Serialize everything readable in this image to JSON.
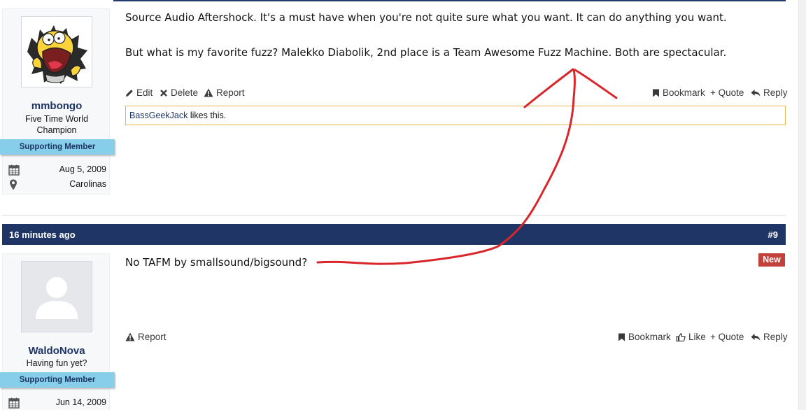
{
  "post1": {
    "author": {
      "username": "mmbongo",
      "title": "Five Time World Champion",
      "banner": "Supporting Member",
      "joined": "Aug 5, 2009",
      "location": "Carolinas",
      "avatar_icon": "homer-simpson-avatar"
    },
    "paragraphs": [
      "Source Audio Aftershock. It's a must have when you're not quite sure what you want. It can do anything you want.",
      "But what is my favorite fuzz? Malekko Diabolik, 2nd place is a Team Awesome Fuzz Machine. Both are spectacular."
    ],
    "actions_left": [
      {
        "label": "Edit",
        "icon": "pencil-icon"
      },
      {
        "label": "Delete",
        "icon": "x-icon"
      },
      {
        "label": "Report",
        "icon": "warning-icon"
      }
    ],
    "actions_right": [
      {
        "label": "Bookmark",
        "icon": "bookmark-icon"
      },
      {
        "label": "+ Quote",
        "icon": ""
      },
      {
        "label": "Reply",
        "icon": "reply-icon"
      }
    ],
    "likes": {
      "user": "BassGeekJack",
      "suffix": " likes this."
    }
  },
  "post2": {
    "header": {
      "time": "16 minutes ago",
      "number": "#9"
    },
    "badge": "New",
    "author": {
      "username": "WaldoNova",
      "title": "Having fun yet?",
      "banner": "Supporting Member",
      "joined": "Jun 14, 2009",
      "avatar_icon": "default-user-avatar"
    },
    "text": "No TAFM by smallsound/bigsound?",
    "actions_left": [
      {
        "label": "Report",
        "icon": "warning-icon"
      }
    ],
    "actions_right": [
      {
        "label": "Bookmark",
        "icon": "bookmark-icon"
      },
      {
        "label": "Like",
        "icon": "thumbs-up-icon"
      },
      {
        "label": "+ Quote",
        "icon": ""
      },
      {
        "label": "Reply",
        "icon": "reply-icon"
      }
    ]
  },
  "colors": {
    "header_bg": "#1f3566",
    "username": "#1e3465",
    "banner_bg": "#87ceeb",
    "likes_border": "#e9b649",
    "new_badge": "#c2413a",
    "annotation_red": "#d9262b"
  }
}
